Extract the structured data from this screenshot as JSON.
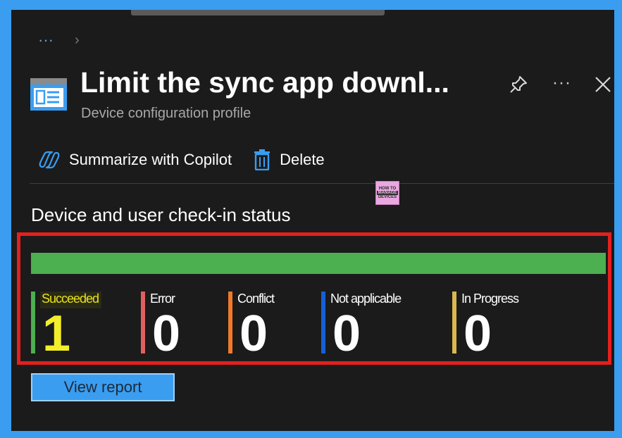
{
  "breadcrumb": {
    "ellipsis": "···",
    "chevron": "›"
  },
  "header": {
    "title": "Limit the sync app downl...",
    "subtitle": "Device configuration profile",
    "more": "···"
  },
  "toolbar": {
    "copilot_label": "Summarize with Copilot",
    "delete_label": "Delete"
  },
  "watermark": {
    "line1": "HOW TO",
    "line2": "MANAGE",
    "line3": "DEVICES"
  },
  "section": {
    "title": "Device and user check-in status"
  },
  "progress": {
    "succeeded_fraction": 1.0
  },
  "stats": [
    {
      "label": "Succeeded",
      "value": "1",
      "color": "#4caf50"
    },
    {
      "label": "Error",
      "value": "0",
      "color": "#e06060"
    },
    {
      "label": "Conflict",
      "value": "0",
      "color": "#f07a2a"
    },
    {
      "label": "Not applicable",
      "value": "0",
      "color": "#1560d8"
    },
    {
      "label": "In Progress",
      "value": "0",
      "color": "#d8b850"
    }
  ],
  "view_report": {
    "label": "View report"
  },
  "colors": {
    "accent": "#3a9df0",
    "highlight": "#e51f1f",
    "success": "#4caf50"
  },
  "icons": [
    "profile-icon",
    "pin-icon",
    "more-icon",
    "close-icon",
    "copilot-icon",
    "trash-icon"
  ]
}
